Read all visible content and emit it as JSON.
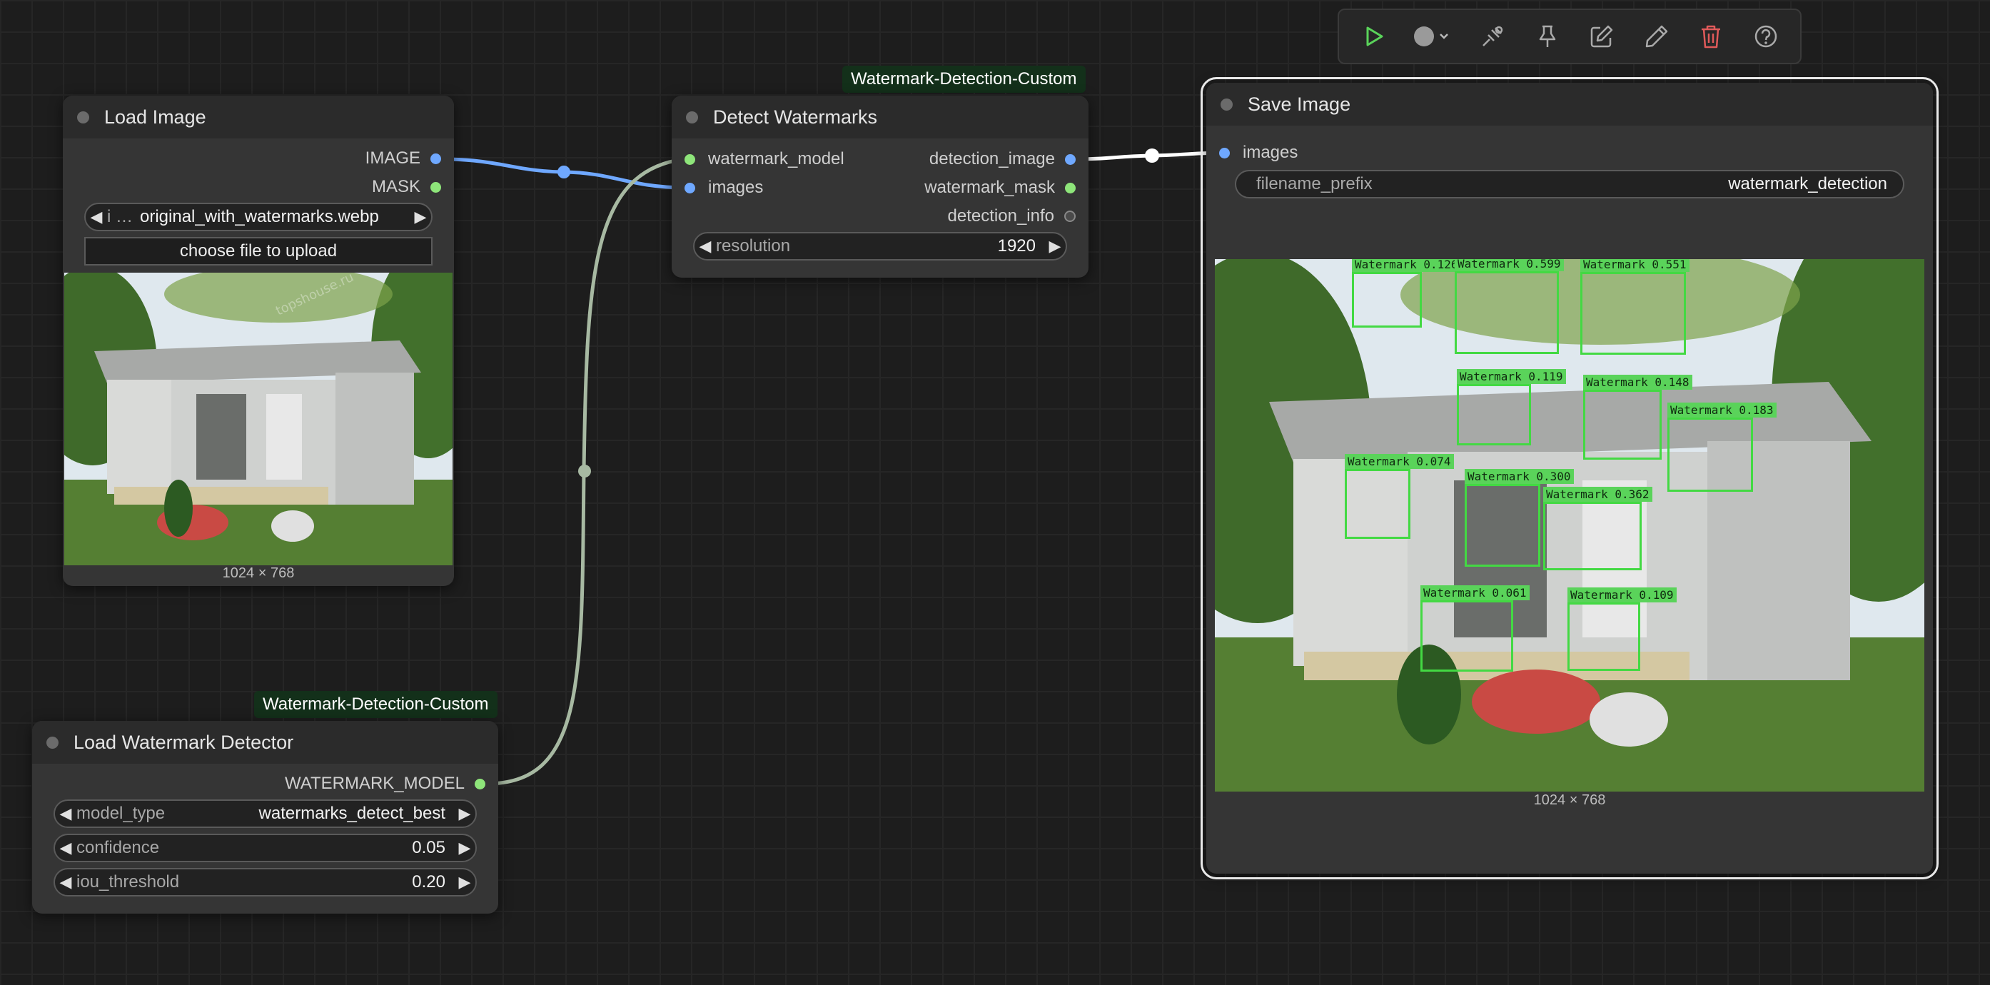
{
  "toolbar": {
    "icons": [
      "play-icon",
      "record-dropdown-icon",
      "lasso-icon",
      "pin-icon",
      "edit-icon",
      "pencil-icon",
      "trash-icon",
      "help-icon"
    ]
  },
  "colors": {
    "image_link": "#6fa8ff",
    "model_link": "#a7b9a2",
    "output_link": "#ffffff",
    "badge_bg": "#13301a",
    "detection_box": "#43d943"
  },
  "nodes": {
    "load_image": {
      "title": "Load Image",
      "outputs": [
        "IMAGE",
        "MASK"
      ],
      "image_combo": {
        "prefix": "i …",
        "value": "original_with_watermarks.webp"
      },
      "upload_button": "choose file to upload",
      "preview_dims": "1024 × 768",
      "watermark_text": "topshouse.ru"
    },
    "detect_watermarks": {
      "badge": "Watermark-Detection-Custom",
      "title": "Detect Watermarks",
      "inputs": [
        "watermark_model",
        "images"
      ],
      "outputs": [
        "detection_image",
        "watermark_mask",
        "detection_info"
      ],
      "resolution": {
        "label": "resolution",
        "value": "1920"
      }
    },
    "load_detector": {
      "badge": "Watermark-Detection-Custom",
      "title": "Load Watermark Detector",
      "output": "WATERMARK_MODEL",
      "widgets": [
        {
          "label": "model_type",
          "value": "watermarks_detect_best"
        },
        {
          "label": "confidence",
          "value": "0.05"
        },
        {
          "label": "iou_threshold",
          "value": "0.20"
        }
      ]
    },
    "save_image": {
      "title": "Save Image",
      "input": "images",
      "filename_prefix": {
        "label": "filename_prefix",
        "value": "watermark_detection"
      },
      "preview_dims": "1024 × 768",
      "detections": [
        "Watermark 0.126",
        "Watermark 0.599",
        "Watermark 0.551",
        "Watermark 0.119",
        "Watermark 0.148",
        "Watermark 0.183",
        "Watermark 0.074",
        "Watermark 0.300",
        "Watermark 0.362",
        "Watermark 0.061",
        "Watermark 0.109"
      ]
    }
  }
}
